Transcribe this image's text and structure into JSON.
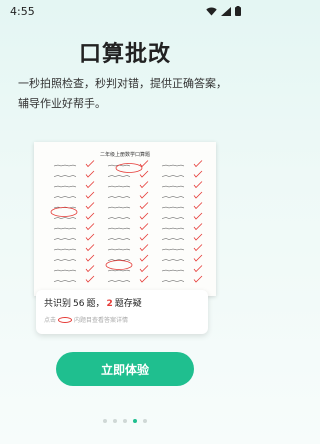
{
  "status_bar": {
    "time": "4:55",
    "icons": [
      "wifi-icon",
      "signal-icon",
      "battery-icon"
    ]
  },
  "hero": {
    "title": "口算批改",
    "description": "一秒拍照检查，秒判对错，提供正确答案，辅导作业好帮手。"
  },
  "worksheet": {
    "title": "二年级上册数学口算题"
  },
  "result": {
    "prefix": "共识别",
    "total": "56",
    "middle": "题，",
    "flagged": "2",
    "suffix": "题存疑",
    "hint_prefix": "点击",
    "hint_suffix": "内题目查看答案详情"
  },
  "cta": {
    "label": "立即体验"
  },
  "pagination": {
    "count": 5,
    "active_index": 3
  },
  "colors": {
    "accent": "#1fbf8f",
    "error": "#e53935"
  }
}
